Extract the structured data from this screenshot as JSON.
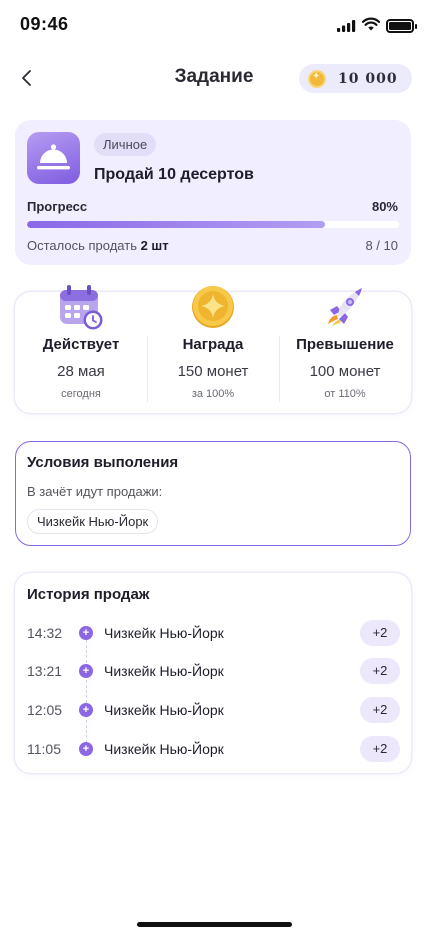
{
  "status_bar": {
    "time": "09:46"
  },
  "header": {
    "title": "Задание",
    "balance": "10 000"
  },
  "task": {
    "tag": "Личное",
    "name": "Продай 10 десертов",
    "progress_label": "Прогресс",
    "progress_percent_text": "80%",
    "progress_fraction": 0.8,
    "remaining_prefix": "Осталось продать ",
    "remaining_amount": "2 шт",
    "count": "8 / 10"
  },
  "stats": [
    {
      "title": "Действует",
      "value": "28 мая",
      "sub": "сегодня",
      "icon": "calendar-icon"
    },
    {
      "title": "Награда",
      "value": "150 монет",
      "sub": "за 100%",
      "icon": "coin-icon"
    },
    {
      "title": "Превышение",
      "value": "100 монет",
      "sub": "от 110%",
      "icon": "rocket-icon"
    }
  ],
  "conditions": {
    "title": "Условия выполения",
    "subtitle": "В зачёт идут продажи:",
    "chip": "Чизкейк Нью-Йорк"
  },
  "history": {
    "title": "История продаж",
    "rows": [
      {
        "time": "14:32",
        "name": "Чизкейк Нью-Йорк",
        "amount": "+2"
      },
      {
        "time": "13:21",
        "name": "Чизкейк Нью-Йорк",
        "amount": "+2"
      },
      {
        "time": "12:05",
        "name": "Чизкейк Нью-Йорк",
        "amount": "+2"
      },
      {
        "time": "11:05",
        "name": "Чизкейк Нью-Йорк",
        "amount": "+2"
      }
    ]
  },
  "colors": {
    "accent": "#8b67e4",
    "card_bg": "#f1efff",
    "coin": "#f2b83a"
  }
}
